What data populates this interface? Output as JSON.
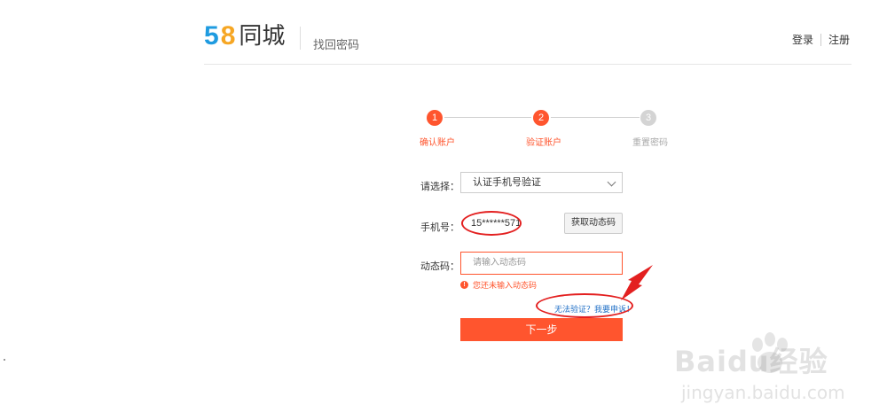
{
  "header": {
    "logo_text": "58同城",
    "page_title": "找回密码",
    "login_label": "登录",
    "register_label": "注册"
  },
  "steps": [
    {
      "number": "1",
      "label": "确认账户",
      "state": "done"
    },
    {
      "number": "2",
      "label": "验证账户",
      "state": "active"
    },
    {
      "number": "3",
      "label": "重置密码",
      "state": "pending"
    }
  ],
  "form": {
    "method_label": "请选择：",
    "method_value": "认证手机号验证",
    "phone_label": "手机号：",
    "phone_value": "15******571",
    "get_code_label": "获取动态码",
    "code_label": "动态码：",
    "code_placeholder": "请输入动态码",
    "code_error": "您还未输入动态码",
    "appeal_link": "无法验证？我要申诉！",
    "next_label": "下一步"
  },
  "watermark": {
    "brand": "Baidu经验",
    "url": "jingyan.baidu.com"
  },
  "colors": {
    "accent": "#ff552e",
    "link": "#1f6fc6",
    "annotation": "#e32020"
  }
}
